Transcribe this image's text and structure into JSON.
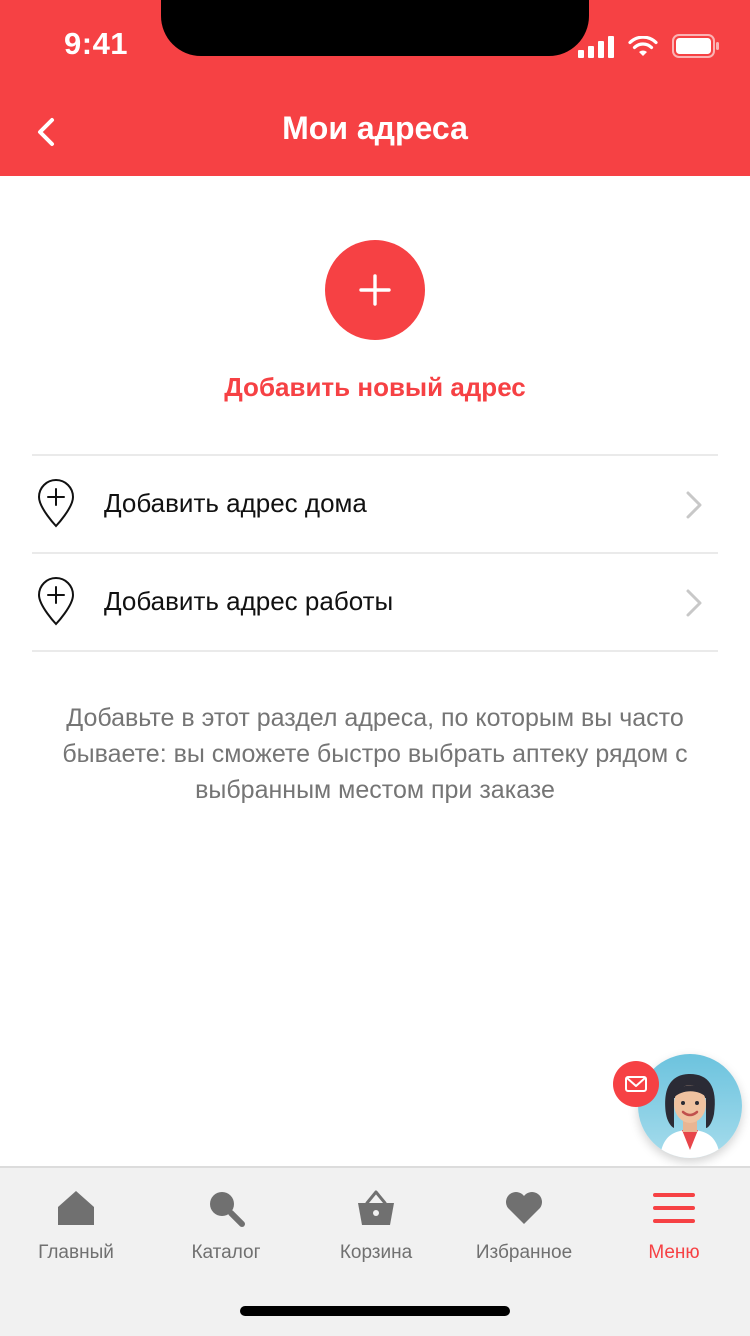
{
  "status_bar": {
    "time": "9:41"
  },
  "header": {
    "title": "Мои адреса"
  },
  "add_address": {
    "label": "Добавить новый адрес"
  },
  "addresses": [
    {
      "label": "Добавить адрес дома"
    },
    {
      "label": "Добавить адрес работы"
    }
  ],
  "hint": "Добавьте в этот раздел адреса, по которым вы часто бываете: вы сможете быстро выбрать аптеку рядом с выбранным местом при заказе",
  "tabbar": {
    "items": [
      {
        "label": "Главный",
        "icon": "home-icon"
      },
      {
        "label": "Каталог",
        "icon": "search-icon"
      },
      {
        "label": "Корзина",
        "icon": "basket-icon"
      },
      {
        "label": "Избранное",
        "icon": "heart-icon"
      },
      {
        "label": "Меню",
        "icon": "menu-icon"
      }
    ],
    "active_index": 4
  },
  "colors": {
    "accent": "#f64144",
    "tab_inactive": "#707070",
    "hint_text": "#757575"
  }
}
